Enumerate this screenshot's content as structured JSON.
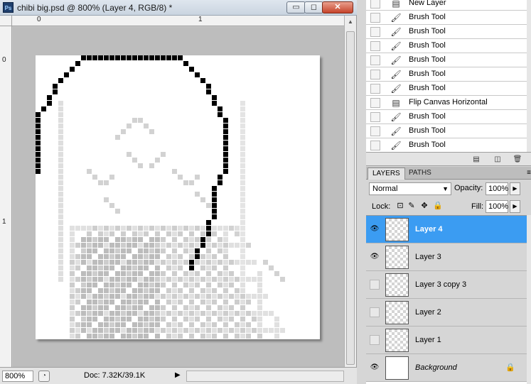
{
  "window": {
    "title": "chibi big.psd @ 800% (Layer 4, RGB/8) *",
    "app_icon": "Ps",
    "min_label": "▭",
    "max_label": "◻",
    "close_label": "✕"
  },
  "rulers": {
    "top_labels": [
      "0",
      "1"
    ],
    "left_labels": [
      "0",
      "1"
    ]
  },
  "status": {
    "zoom": "800%",
    "doc_info": "Doc: 7.32K/39.1K",
    "arrow": "▶"
  },
  "history": {
    "items": [
      {
        "label": "New Layer",
        "icon": "document-icon"
      },
      {
        "label": "Brush Tool",
        "icon": "brush-icon"
      },
      {
        "label": "Brush Tool",
        "icon": "brush-icon"
      },
      {
        "label": "Brush Tool",
        "icon": "brush-icon"
      },
      {
        "label": "Brush Tool",
        "icon": "brush-icon"
      },
      {
        "label": "Brush Tool",
        "icon": "brush-icon"
      },
      {
        "label": "Brush Tool",
        "icon": "brush-icon"
      },
      {
        "label": "Flip Canvas Horizontal",
        "icon": "document-icon"
      },
      {
        "label": "Brush Tool",
        "icon": "brush-icon"
      },
      {
        "label": "Brush Tool",
        "icon": "brush-icon"
      },
      {
        "label": "Brush Tool",
        "icon": "brush-icon"
      }
    ]
  },
  "layers_panel": {
    "tab_layers": "LAYERS",
    "tab_paths": "PATHS",
    "blend_mode": "Normal",
    "opacity_label": "Opacity:",
    "opacity_value": "100%",
    "lock_label": "Lock:",
    "fill_label": "Fill:",
    "fill_value": "100%",
    "layers": [
      {
        "name": "Layer 4",
        "visible": true,
        "selected": true
      },
      {
        "name": "Layer 3",
        "visible": true,
        "selected": false
      },
      {
        "name": "Layer 3 copy 3",
        "visible": false,
        "selected": false
      },
      {
        "name": "Layer 2",
        "visible": false,
        "selected": false
      },
      {
        "name": "Layer 1",
        "visible": false,
        "selected": false
      },
      {
        "name": "Background",
        "visible": true,
        "selected": false,
        "locked": true
      }
    ]
  },
  "colors": {
    "selection": "#3b9cf2",
    "close_button": "#c6432a"
  }
}
